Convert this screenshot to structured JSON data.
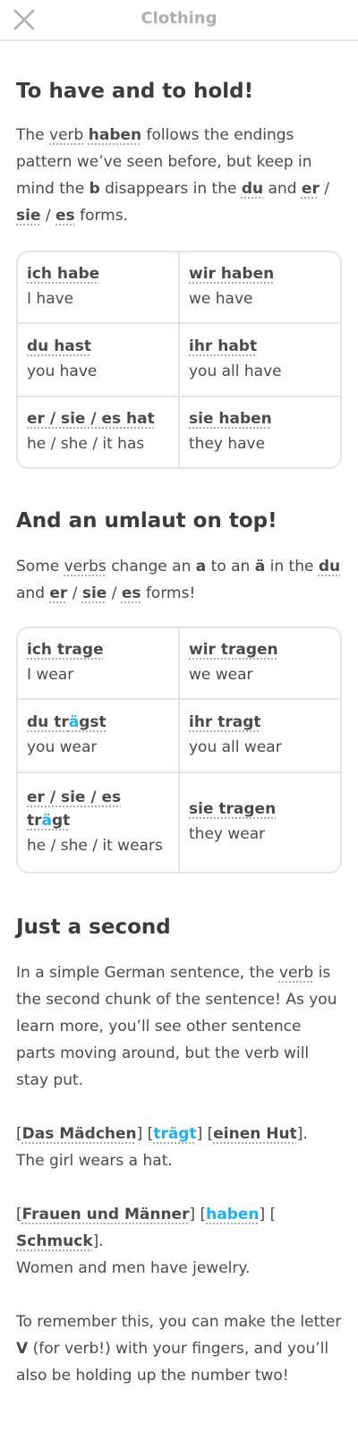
{
  "header": {
    "title": "Clothing",
    "close_icon": "close-icon"
  },
  "section1": {
    "heading": "To have and to hold!",
    "paragraph": {
      "t1": "The ",
      "verb": "verb",
      "t2": " ",
      "haben": "haben",
      "t3": " follows the endings pattern we’ve seen before, but keep in mind the ",
      "b": "b",
      "t4": " disappears in the ",
      "du": "du",
      "t5": " and ",
      "er": "er",
      "s1": " / ",
      "sie": "sie",
      "s2": " / ",
      "es": "es",
      "t6": " forms."
    },
    "table": [
      [
        {
          "form": "ich habe",
          "translation": "I have"
        },
        {
          "form": "wir haben",
          "translation": "we have"
        }
      ],
      [
        {
          "form": "du hast",
          "translation": "you have"
        },
        {
          "form": "ihr habt",
          "translation": "you all have"
        }
      ],
      [
        {
          "form": "er / sie / es hat",
          "translation": "he / she / it has"
        },
        {
          "form": "sie haben",
          "translation": "they have"
        }
      ]
    ]
  },
  "section2": {
    "heading": "And an umlaut on top!",
    "paragraph": {
      "t1": "Some ",
      "verbs": "verbs",
      "t2": " change an ",
      "a": "a",
      "t3": " to an ",
      "ae": "ä",
      "t4": " in the ",
      "du": "du",
      "t5": " and ",
      "er": "er",
      "s1": " / ",
      "sie": "sie",
      "s2": " / ",
      "es": "es",
      "t6": " forms!"
    },
    "table": [
      [
        {
          "form": "ich trage",
          "translation": "I wear"
        },
        {
          "form": "wir tragen",
          "translation": "we wear"
        }
      ],
      [
        {
          "form_pre": "du tr",
          "form_umlaut": "ä",
          "form_post": "gst",
          "translation": "you wear"
        },
        {
          "form": "ihr tragt",
          "translation": "you all wear"
        }
      ],
      [
        {
          "form_pre": "er / sie / es tr",
          "form_umlaut": "ä",
          "form_post": "gt",
          "translation": "he / she / it wears"
        },
        {
          "form": "sie tragen",
          "translation": "they wear"
        }
      ]
    ]
  },
  "section3": {
    "heading": "Just a second",
    "p1": {
      "t1": "In a simple German sentence, the ",
      "verb": "verb",
      "t2": " is the second chunk of the sentence! As you learn more, you’ll see other sentence parts moving around, but the verb will stay put."
    },
    "ex1": {
      "b1": "[",
      "c1": "Das Mädchen",
      "b2": "] [",
      "c2": "trägt",
      "b3": "] [",
      "c3": "einen Hut",
      "b4": "].",
      "translation": "The girl wears a hat."
    },
    "ex2": {
      "b1": "[",
      "c1": "Frauen und Männer",
      "b2": "] [",
      "c2": "haben",
      "b3": "] [",
      "c3": "Schmuck",
      "b4": "].",
      "translation": "Women and men have jewelry."
    },
    "p2": {
      "t1": "To remember this, you can make the letter ",
      "v": "V",
      "t2": " (for verb!) with your fingers, and you’ll also be holding up the number two!"
    }
  }
}
